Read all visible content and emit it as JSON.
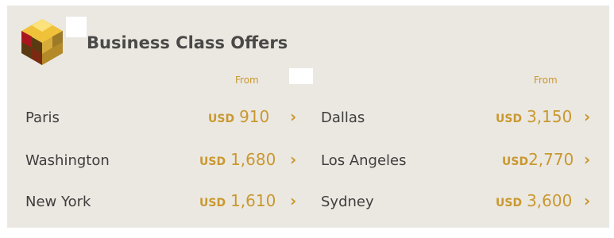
{
  "header": {
    "title": "Business Class Offers",
    "from_left": "From",
    "from_right": "From",
    "logo_icon": "gold-cube-logo-icon"
  },
  "colors": {
    "panel_bg": "#ebe8e2",
    "accent": "#c9982f",
    "text": "#3f3e3d",
    "title": "#4b4948"
  },
  "offers_left": [
    {
      "city": "Paris",
      "currency": "USD",
      "amount": "910"
    },
    {
      "city": "Washington",
      "currency": "USD",
      "amount": "1,680"
    },
    {
      "city": "New York",
      "currency": "USD",
      "amount": "1,610"
    }
  ],
  "offers_right": [
    {
      "city": "Dallas",
      "currency": "USD",
      "amount": "3,150"
    },
    {
      "city": "Los Angeles",
      "currency": "USD",
      "amount": "2,770"
    },
    {
      "city": "Sydney",
      "currency": "USD",
      "amount": "3,600"
    }
  ],
  "chevron": "›"
}
